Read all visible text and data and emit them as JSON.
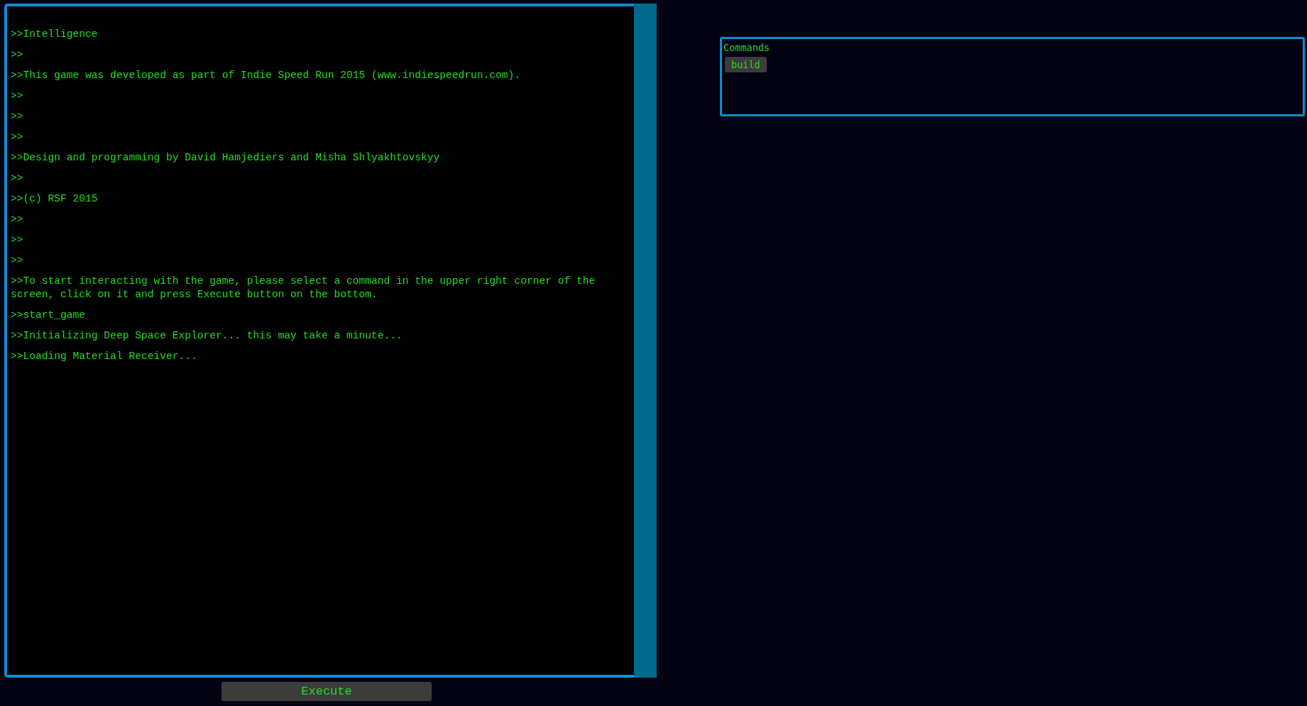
{
  "console": {
    "lines": [
      ">>Intelligence",
      ">>",
      ">>This game was developed as part of Indie Speed Run 2015 (www.indiespeedrun.com).",
      ">>",
      ">>",
      ">>",
      ">>Design and programming by David Hamjediers and Misha Shlyakhtovskyy",
      ">>",
      ">>(c) RSF 2015",
      ">>",
      ">>",
      ">>",
      ">>To start interacting with the game, please select a command in the upper right corner of the screen, click on it and press Execute button on the bottom.",
      ">>start_game",
      ">>Initializing Deep Space Explorer... this may take a minute...",
      ">>Loading Material Receiver..."
    ]
  },
  "execute_button": "Execute",
  "commands": {
    "title": "Commands",
    "items": [
      "build"
    ]
  }
}
